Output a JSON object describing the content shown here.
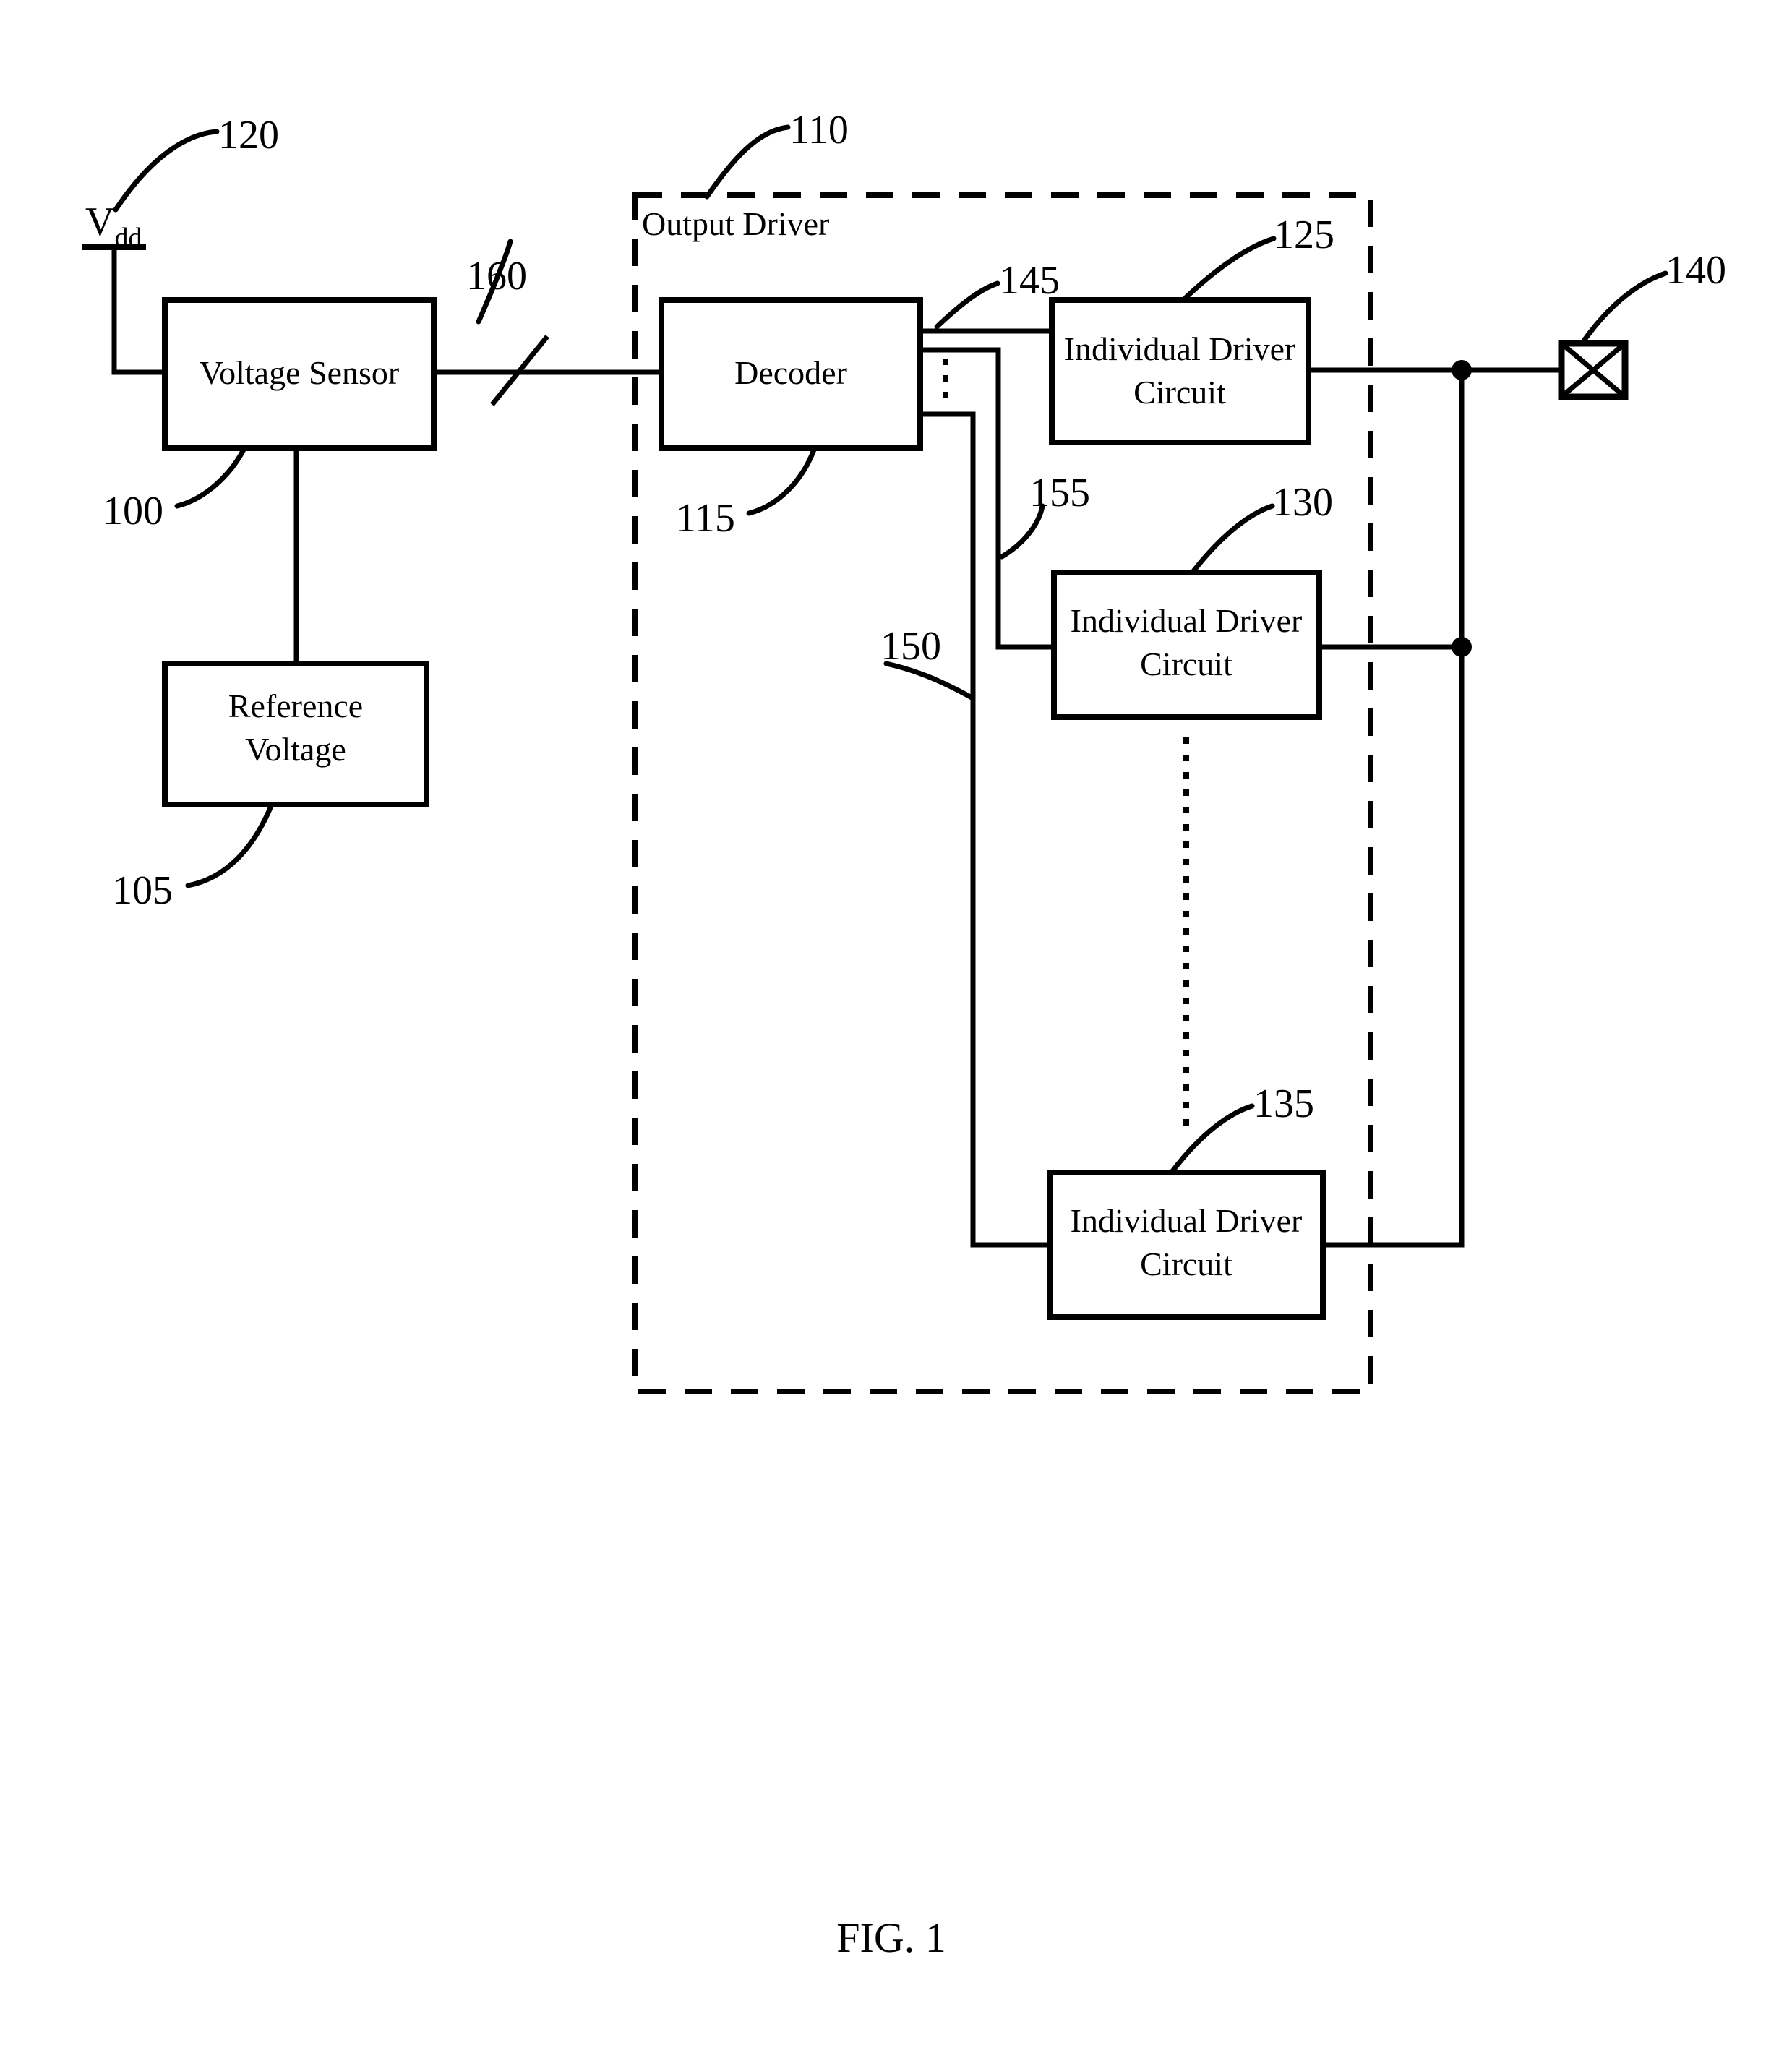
{
  "figure": {
    "caption": "FIG. 1",
    "title_block": "Output Driver"
  },
  "blocks": {
    "voltage_sensor": {
      "label": "Voltage Sensor",
      "ref": "100"
    },
    "reference_voltage": {
      "label_line1": "Reference",
      "label_line2": "Voltage",
      "ref": "105"
    },
    "decoder": {
      "label": "Decoder",
      "ref": "115"
    },
    "driver_1": {
      "label_line1": "Individual Driver",
      "label_line2": "Circuit",
      "ref": "125"
    },
    "driver_2": {
      "label_line1": "Individual Driver",
      "label_line2": "Circuit",
      "ref": "130"
    },
    "driver_n": {
      "label_line1": "Individual Driver",
      "label_line2": "Circuit",
      "ref": "135"
    },
    "output_driver_group": {
      "label": "Output Driver",
      "ref": "110"
    },
    "pad": {
      "ref": "140"
    }
  },
  "signals": {
    "supply": {
      "name": "V",
      "subscript": "dd",
      "ref": "120"
    },
    "sensor_bus": {
      "ref": "160"
    },
    "decoder_out_1": {
      "ref": "145"
    },
    "decoder_out_2": {
      "ref": "155"
    },
    "decoder_out_n": {
      "ref": "150"
    }
  },
  "reference_numerals": [
    "100",
    "105",
    "110",
    "115",
    "120",
    "125",
    "130",
    "135",
    "140",
    "145",
    "150",
    "155",
    "160"
  ],
  "colors": {
    "stroke": "#000000",
    "background": "#ffffff"
  }
}
